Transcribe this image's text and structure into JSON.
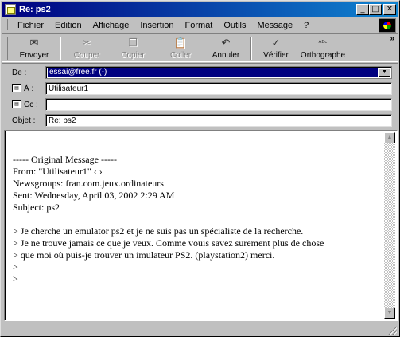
{
  "window": {
    "title": "Re: ps2",
    "minimize": "_",
    "maximize": "□",
    "close": "✕"
  },
  "menu": [
    {
      "label": "Fichier"
    },
    {
      "label": "Edition"
    },
    {
      "label": "Affichage"
    },
    {
      "label": "Insertion"
    },
    {
      "label": "Format"
    },
    {
      "label": "Outils"
    },
    {
      "label": "Message"
    },
    {
      "label": "?"
    }
  ],
  "toolbar": {
    "send": {
      "label": "Envoyer",
      "icon": "send-icon",
      "glyph": "✉"
    },
    "cut": {
      "label": "Couper",
      "icon": "scissors-icon",
      "glyph": "✂"
    },
    "copy": {
      "label": "Copier",
      "icon": "copy-icon",
      "glyph": "❐"
    },
    "paste": {
      "label": "Coller",
      "icon": "paste-icon",
      "glyph": "📋"
    },
    "undo": {
      "label": "Annuler",
      "icon": "undo-icon",
      "glyph": "↶"
    },
    "check": {
      "label": "Vérifier",
      "icon": "check-names-icon",
      "glyph": "✓"
    },
    "spelling": {
      "label": "Orthographe",
      "icon": "spelling-icon",
      "glyph": "ᴬᴮᶜ"
    },
    "more": "»"
  },
  "headers": {
    "from_label": "De :",
    "from_value": "essai@free.fr   (-)",
    "to_label": "À :",
    "to_value": "Utilisateur1",
    "cc_label": "Cc :",
    "cc_value": "",
    "subject_label": "Objet :",
    "subject_value": "Re: ps2"
  },
  "message": {
    "lines": [
      "",
      "----- Original Message -----",
      "From: \"Utilisateur1\" ‹                                              ›",
      "Newsgroups: fran.com.jeux.ordinateurs",
      "Sent: Wednesday, April 03, 2002 2:29 AM",
      "Subject: ps2",
      "",
      "> Je cherche un emulator ps2 et je ne suis pas un spécialiste de la recherche.",
      "> Je ne trouve jamais ce que je veux. Comme vouis savez surement plus de chose",
      "> que moi où puis-je trouver un imulateur PS2. (playstation2) merci.",
      ">",
      ">"
    ]
  },
  "colors": {
    "titlebar": "#000080",
    "face": "#c0c0c0"
  }
}
